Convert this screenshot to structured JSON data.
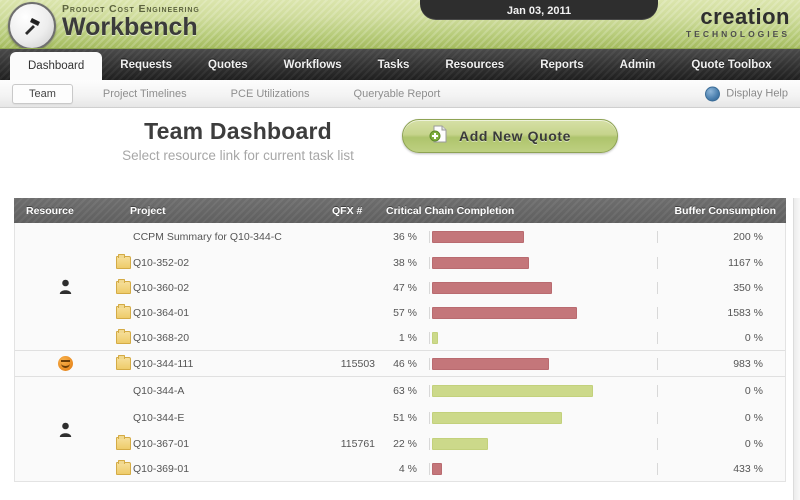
{
  "header": {
    "eyebrow": "Product Cost Engineering",
    "title": "Workbench",
    "date": "Jan 03, 2011",
    "corp_name": "creation",
    "corp_sub": "TECHNOLOGIES",
    "logo_icon": "hammer-icon"
  },
  "mainnav": {
    "items": [
      {
        "label": "Dashboard",
        "active": true
      },
      {
        "label": "Requests",
        "active": false
      },
      {
        "label": "Quotes",
        "active": false
      },
      {
        "label": "Workflows",
        "active": false
      },
      {
        "label": "Tasks",
        "active": false
      },
      {
        "label": "Resources",
        "active": false
      },
      {
        "label": "Reports",
        "active": false
      },
      {
        "label": "Admin",
        "active": false
      },
      {
        "label": "Quote Toolbox",
        "active": false
      }
    ]
  },
  "subnav": {
    "items": [
      {
        "label": "Team",
        "active": true
      },
      {
        "label": "Project Timelines",
        "active": false
      },
      {
        "label": "PCE Utilizations",
        "active": false
      },
      {
        "label": "Queryable Report",
        "active": false
      }
    ],
    "help_label": "Display Help",
    "help_icon": "help-circle-icon"
  },
  "page": {
    "title": "Team Dashboard",
    "subtitle": "Select resource link for current task list",
    "add_quote_label": "Add New Quote",
    "add_quote_icon": "document-add-icon"
  },
  "table": {
    "columns": {
      "resource": "Resource",
      "project": "Project",
      "qfx": "QFX #",
      "ccc": "Critical Chain Completion",
      "buffer": "Buffer Consumption"
    },
    "bar_max_pct": 100,
    "colors": {
      "over": "#c4767a",
      "ok": "#ccd98a"
    },
    "groups": [
      {
        "resource_icon": "person-icon",
        "rows": [
          {
            "folder": false,
            "project": "CCPM Summary for Q10-344-C",
            "qfx": "",
            "ccc": "36 %",
            "ccc_value": 36,
            "bar_color": "over",
            "buffer": "200 %"
          },
          {
            "folder": true,
            "project": "Q10-352-02",
            "qfx": "",
            "ccc": "38 %",
            "ccc_value": 38,
            "bar_color": "over",
            "buffer": "1167 %"
          },
          {
            "folder": true,
            "project": "Q10-360-02",
            "qfx": "",
            "ccc": "47 %",
            "ccc_value": 47,
            "bar_color": "over",
            "buffer": "350 %"
          },
          {
            "folder": true,
            "project": "Q10-364-01",
            "qfx": "",
            "ccc": "57 %",
            "ccc_value": 57,
            "bar_color": "over",
            "buffer": "1583 %"
          },
          {
            "folder": true,
            "project": "Q10-368-20",
            "qfx": "",
            "ccc": "1 %",
            "ccc_value": 1,
            "bar_color": "ok",
            "buffer": "0 %"
          }
        ]
      },
      {
        "resource_icon": "smiley-icon",
        "rows": [
          {
            "folder": true,
            "project": "Q10-344-111",
            "qfx": "115503",
            "ccc": "46 %",
            "ccc_value": 46,
            "bar_color": "over",
            "buffer": "983 %"
          }
        ]
      },
      {
        "resource_icon": "person-icon",
        "rows": [
          {
            "folder": false,
            "project": "Q10-344-A",
            "qfx": "",
            "ccc": "63 %",
            "ccc_value": 63,
            "bar_color": "ok",
            "buffer": "0 %"
          },
          {
            "folder": false,
            "project": "Q10-344-E",
            "qfx": "",
            "ccc": "51 %",
            "ccc_value": 51,
            "bar_color": "ok",
            "buffer": "0 %"
          },
          {
            "folder": true,
            "project": "Q10-367-01",
            "qfx": "115761",
            "ccc": "22 %",
            "ccc_value": 22,
            "bar_color": "ok",
            "buffer": "0 %"
          },
          {
            "folder": true,
            "project": "Q10-369-01",
            "qfx": "",
            "ccc": "4 %",
            "ccc_value": 4,
            "bar_color": "over",
            "buffer": "433 %"
          }
        ]
      }
    ]
  }
}
